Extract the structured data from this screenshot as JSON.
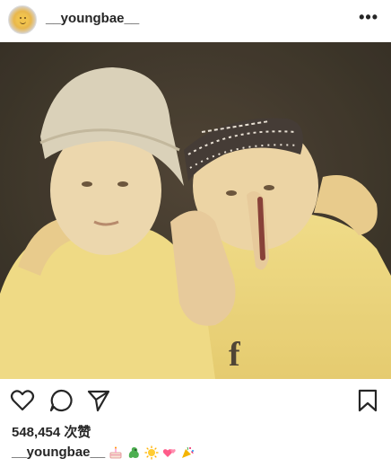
{
  "header": {
    "username": "__youngbae__",
    "more_label": "•••",
    "avatar_icon": "sun-avatar"
  },
  "post": {
    "image_alt": "photo of two boys",
    "user_tag_icon": "person-icon"
  },
  "actions": {
    "like_icon": "heart-icon",
    "comment_icon": "comment-icon",
    "share_icon": "send-icon",
    "save_icon": "bookmark-icon"
  },
  "likes": {
    "text": "548,454 次赞"
  },
  "caption": {
    "username": "__youngbae__",
    "emojis": [
      "cake-emoji",
      "dragon-emoji",
      "sun-emoji",
      "two-hearts-emoji",
      "party-popper-emoji"
    ]
  },
  "colors": {
    "text": "#262626",
    "photo_tone": "#e8d07a"
  }
}
